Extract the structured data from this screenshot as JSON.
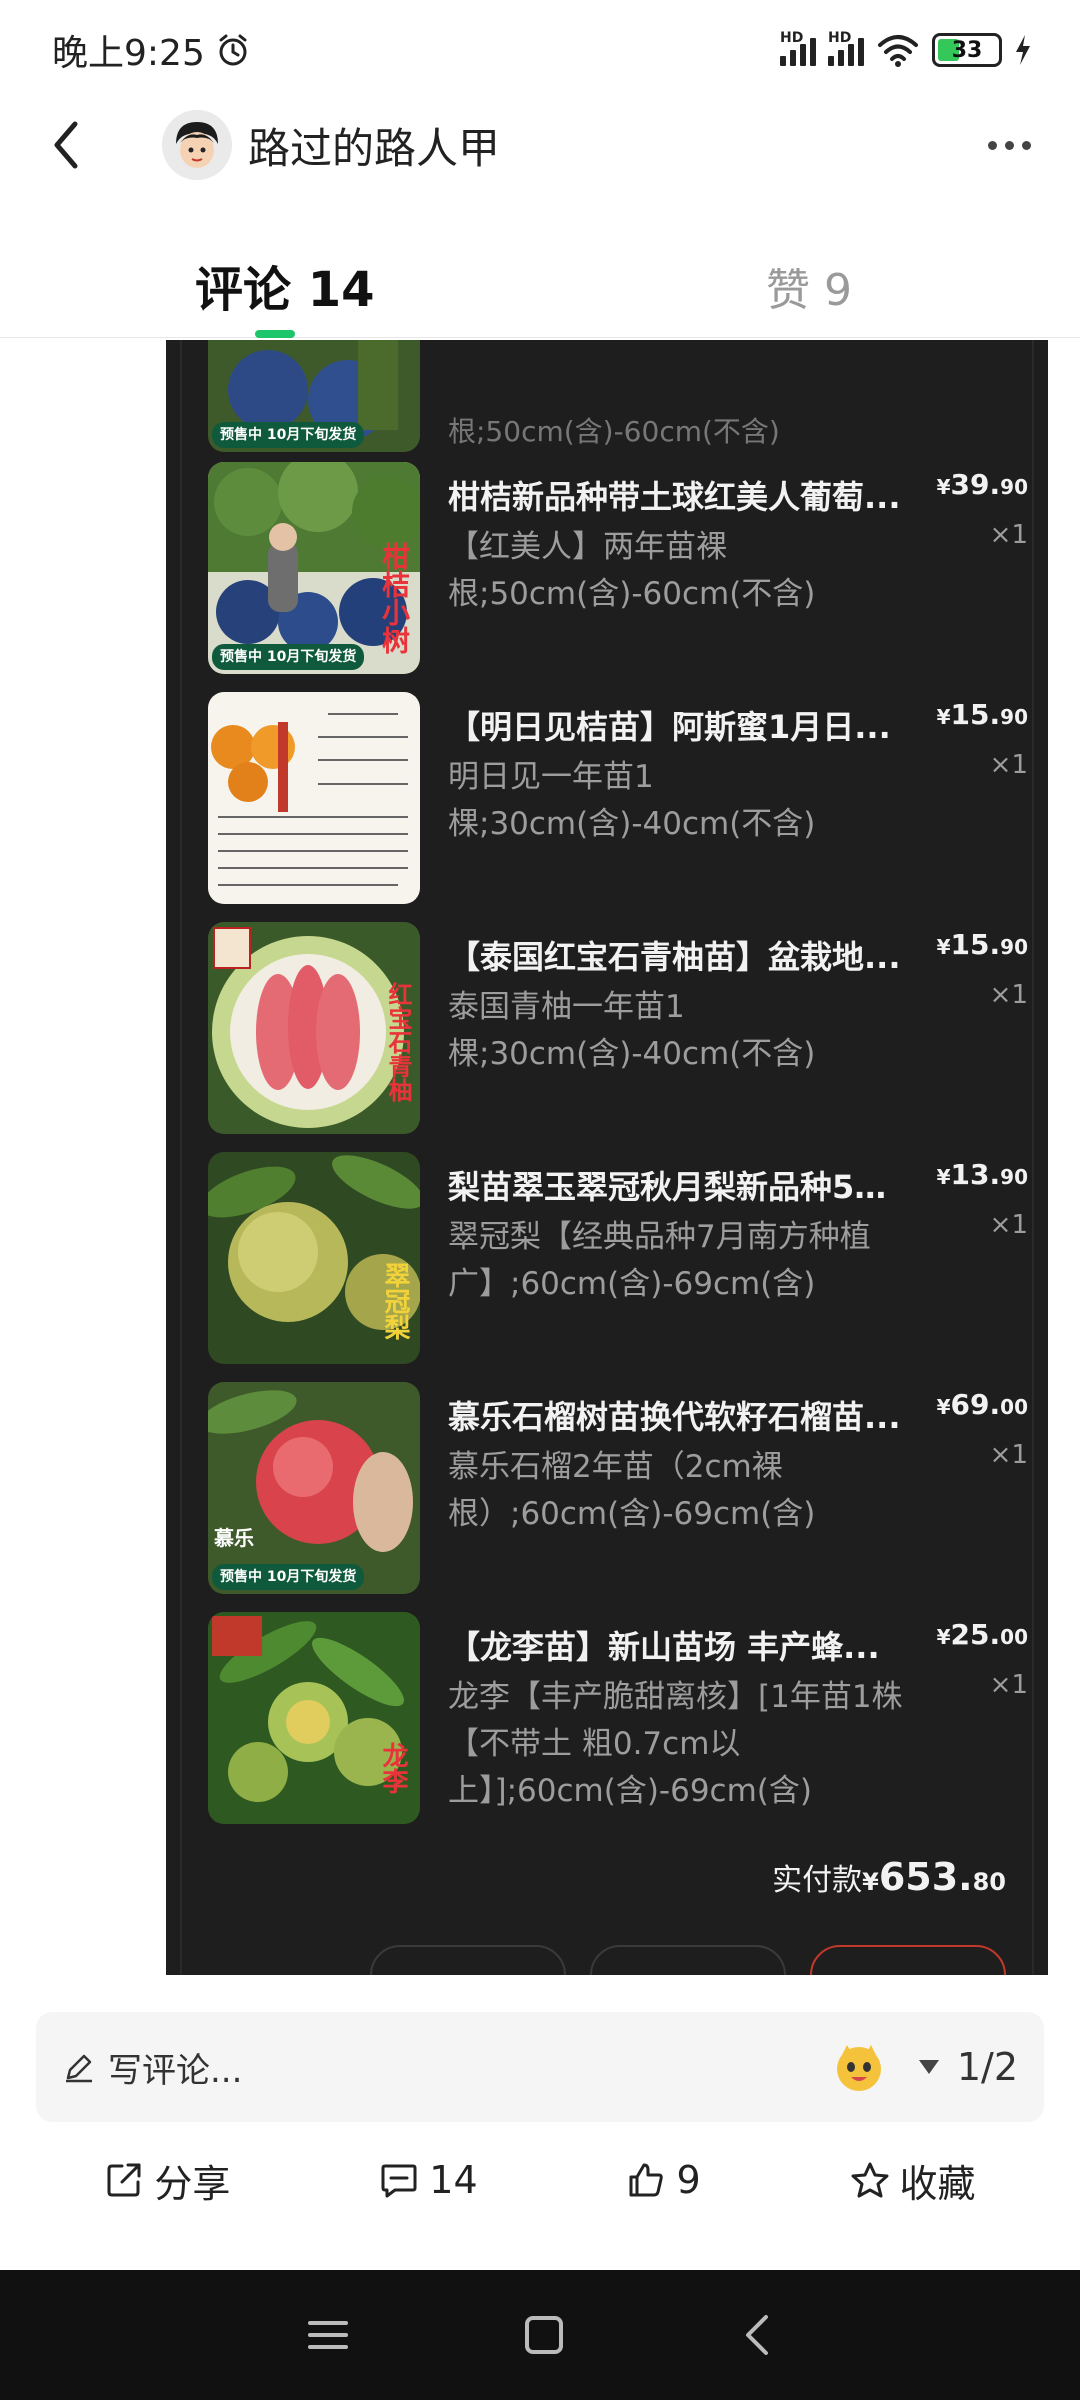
{
  "status_bar": {
    "time": "晚上9:25",
    "signal_label_1": "HD",
    "signal_label_2": "HD",
    "battery_level": "33"
  },
  "header": {
    "username": "路过的路人甲"
  },
  "tabs": {
    "comments": "评论 14",
    "likes": "赞 9"
  },
  "order": {
    "items": [
      {
        "title": "柑桔新品种带土球红美人葡萄...",
        "spec": "【红美人】两年苗裸根;50cm(含)-60cm(不含)",
        "price_int": "39.",
        "price_dec": "90",
        "qty": "×1",
        "thumb_label": "柑桔小树",
        "presale": "预售中 10月下旬发货"
      },
      {
        "title": "【明日见桔苗】阿斯蜜1月日...",
        "spec": "明日见一年苗1棵;30cm(含)-40cm(不含)",
        "price_int": "15.",
        "price_dec": "90",
        "qty": "×1",
        "thumb_label": "",
        "presale": ""
      },
      {
        "title": "【泰国红宝石青柚苗】盆栽地...",
        "spec": "泰国青柚一年苗1棵;30cm(含)-40cm(不含)",
        "price_int": "15.",
        "price_dec": "90",
        "qty": "×1",
        "thumb_label": "红宝石青柚",
        "presale": ""
      },
      {
        "title": "梨苗翠玉翠冠秋月梨新品种51...",
        "spec": "翠冠梨【经典品种7月南方种植广】;60cm(含)-69cm(含)",
        "price_int": "13.",
        "price_dec": "90",
        "qty": "×1",
        "thumb_label": "翠冠梨",
        "presale": ""
      },
      {
        "title": "慕乐石榴树苗换代软籽石榴苗...",
        "spec": "慕乐石榴2年苗（2cm裸根）;60cm(含)-69cm(含)",
        "price_int": "69.",
        "price_dec": "00",
        "qty": "×1",
        "thumb_label": "慕乐",
        "presale": "预售中 10月下旬发货"
      },
      {
        "title": "【龙李苗】新山苗场 丰产蜂...",
        "spec": "龙李【丰产脆甜离核】[1年苗1株【不带土 粗0.7cm以上】];60cm(含)-69cm(含)",
        "price_int": "25.",
        "price_dec": "00",
        "qty": "×1",
        "thumb_label": "龙李",
        "presale": ""
      }
    ],
    "total_label": "实付款",
    "total_int": "653.",
    "total_dec": "80",
    "currency": "¥"
  },
  "comment_bar": {
    "placeholder": "写评论...",
    "page_indicator": "1/2"
  },
  "actions": {
    "share": "分享",
    "comments": "14",
    "likes": "9",
    "favorite": "收藏"
  },
  "colors": {
    "accent": "#1ec66b",
    "panel_bg": "#1e1e1e"
  }
}
